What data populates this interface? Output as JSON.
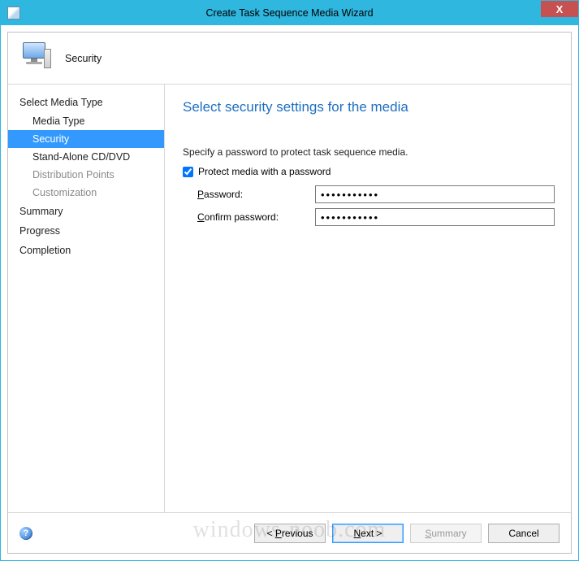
{
  "window": {
    "title": "Create Task Sequence Media Wizard",
    "close_glyph": "X"
  },
  "header": {
    "page_title": "Security"
  },
  "sidebar": {
    "groups": [
      {
        "label": "Select Media Type",
        "enabled": true
      },
      {
        "label": "Summary",
        "enabled": true
      },
      {
        "label": "Progress",
        "enabled": true
      },
      {
        "label": "Completion",
        "enabled": true
      }
    ],
    "items": {
      "media_type": "Media Type",
      "security": "Security",
      "standalone": "Stand-Alone CD/DVD",
      "distribution_points": "Distribution Points",
      "customization": "Customization"
    }
  },
  "content": {
    "heading": "Select security settings for the media",
    "description": "Specify a password to protect task sequence media.",
    "protect_checkbox_label": "Protect media with a password",
    "protect_checked": true,
    "password_label_prefix": "P",
    "password_label_rest": "assword:",
    "confirm_label_prefix": "C",
    "confirm_label_rest": "onfirm password:",
    "password_value": "•••••••••••",
    "confirm_value": "•••••••••••"
  },
  "footer": {
    "help_glyph": "?",
    "previous_prefix": "< ",
    "previous_u": "P",
    "previous_rest": "revious",
    "next_u": "N",
    "next_rest": "ext >",
    "summary_u": "S",
    "summary_rest": "ummary",
    "cancel": "Cancel"
  },
  "watermark": "windows-noob.com"
}
